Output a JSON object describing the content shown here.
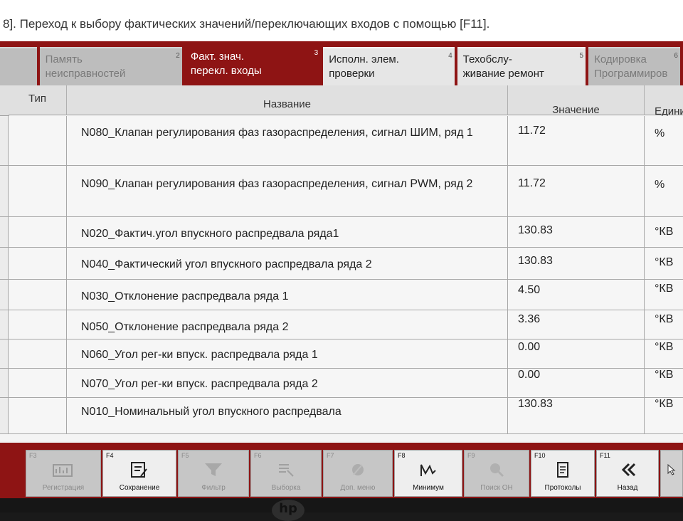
{
  "hint": {
    "text": "8]. Переход к выбору фактических значений/переключающих входов с помощью [F11]."
  },
  "tabs": [
    {
      "num": "2",
      "label": "Память\nнеисправностей",
      "state": "disabled"
    },
    {
      "num": "3",
      "label": "Факт. знач.\nперекл. входы",
      "state": "active"
    },
    {
      "num": "4",
      "label": "Исполн. элем.\nпроверки",
      "state": "enabled"
    },
    {
      "num": "5",
      "label": "Техобслу-\nживание ремонт",
      "state": "enabled"
    },
    {
      "num": "6",
      "label": "Кодировка\nПрограммиров",
      "state": "disabled"
    }
  ],
  "table": {
    "headers": {
      "type": "Тип",
      "name": "Название",
      "value": "Значение",
      "unit": "Едини"
    },
    "rows": [
      {
        "name": "N080_Клапан регулирования фаз газораспределения, сигнал ШИМ, ряд 1",
        "value": "11.72",
        "unit": "%"
      },
      {
        "name": "N090_Клапан регулирования фаз газораспределения, сигнал PWM, ряд 2",
        "value": "11.72",
        "unit": "%"
      },
      {
        "name": "N020_Фактич.угол впускного распредвала ряда1",
        "value": "130.83",
        "unit": "°КВ"
      },
      {
        "name": "N040_Фактический угол впускного распредвала ряда 2",
        "value": "130.83",
        "unit": "°КВ"
      },
      {
        "name": "N030_Отклонение распредвала ряда 1",
        "value": "4.50",
        "unit": "°КВ"
      },
      {
        "name": "N050_Отклонение распредвала ряда 2",
        "value": "3.36",
        "unit": "°КВ"
      },
      {
        "name": "N060_Угол рег-ки впуск. распредвала ряда 1",
        "value": "0.00",
        "unit": "°КВ"
      },
      {
        "name": "N070_Угол рег-ки впуск. распредвала ряда 2",
        "value": "0.00",
        "unit": "°КВ"
      },
      {
        "name": "N010_Номинальный угол впускного распредвала",
        "value": "130.83",
        "unit": "°КВ"
      }
    ]
  },
  "toolbar": [
    {
      "key": "F3",
      "label": "Регистрация",
      "icon": "chart-icon",
      "enabled": false
    },
    {
      "key": "F4",
      "label": "Сохранение",
      "icon": "save-icon",
      "enabled": true
    },
    {
      "key": "F5",
      "label": "Фильтр",
      "icon": "filter-icon",
      "enabled": false
    },
    {
      "key": "F6",
      "label": "Выборка",
      "icon": "selection-icon",
      "enabled": false
    },
    {
      "key": "F7",
      "label": "Доп. меню",
      "icon": "extra-menu-icon",
      "enabled": false
    },
    {
      "key": "F8",
      "label": "Минимум",
      "icon": "minimum-icon",
      "enabled": true
    },
    {
      "key": "F9",
      "label": "Поиск OH",
      "icon": "search-icon",
      "enabled": false
    },
    {
      "key": "F10",
      "label": "Протоколы",
      "icon": "protocol-icon",
      "enabled": true
    },
    {
      "key": "F11",
      "label": "Назад",
      "icon": "back-icon",
      "enabled": true
    }
  ],
  "colors": {
    "accent": "#8e1414",
    "header_bg": "#e0e0e0",
    "row_bg": "#f6f6f6"
  },
  "bezel": {
    "logo": "hp"
  }
}
